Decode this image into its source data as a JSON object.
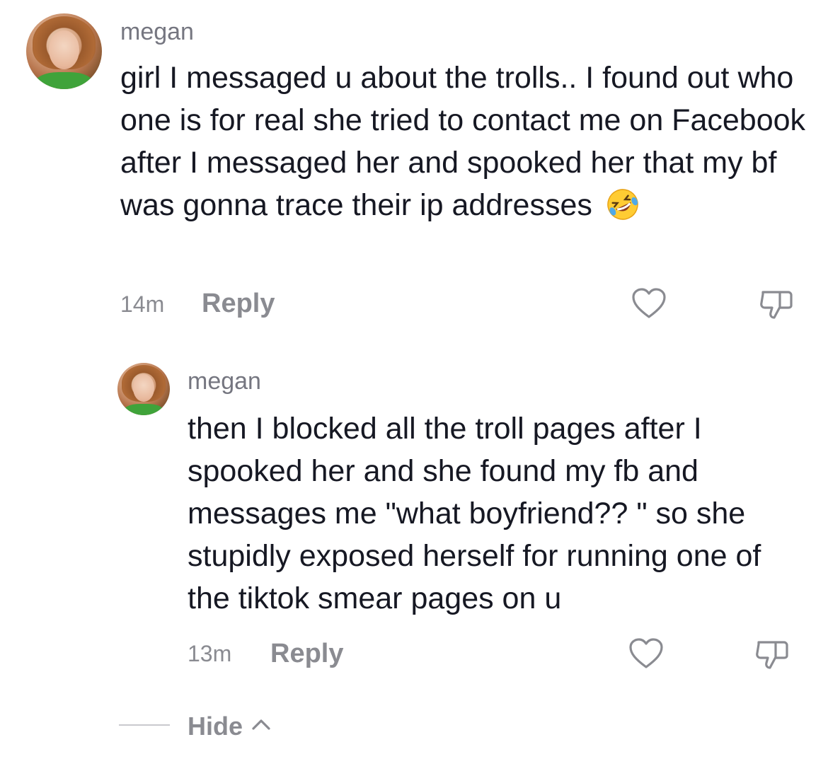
{
  "comments": [
    {
      "username": "megan",
      "text": "girl I messaged u about the trolls.. I found out who one is for real she tried to contact me on Facebook after I messaged her and spooked her that my bf was gonna trace their ip addresses",
      "emoji": "🤣",
      "time": "14m",
      "reply_label": "Reply"
    },
    {
      "username": "megan",
      "text": "then I blocked all the troll pages after I spooked her and she found my fb and messages me \"what boyfriend?? \" so she stupidly exposed herself for running one of the tiktok smear pages on u",
      "time": "13m",
      "reply_label": "Reply"
    }
  ],
  "hide_label": "Hide",
  "icons": {
    "like": "heart-outline-icon",
    "dislike": "thumbs-down-outline-icon",
    "collapse": "chevron-up-icon"
  }
}
